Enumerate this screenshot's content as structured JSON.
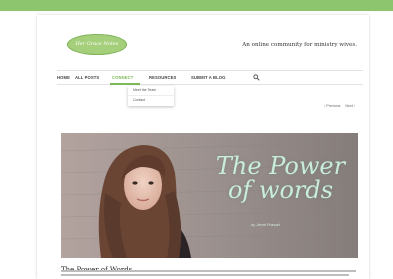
{
  "header": {
    "logo_text": "Her Grace Notes",
    "tagline": "An online community for ministry wives."
  },
  "nav": {
    "items": [
      {
        "label": "HOME"
      },
      {
        "label": "ALL POSTS"
      },
      {
        "label": "CONNECT"
      },
      {
        "label": "RESOURCES"
      },
      {
        "label": "SUBMIT A BLOG"
      }
    ],
    "active": "CONNECT",
    "search_icon": "search-icon"
  },
  "dropdown": {
    "items": [
      {
        "label": "Meet the Team"
      },
      {
        "label": "Contact"
      }
    ]
  },
  "post_nav": {
    "previous": "‹ Previous",
    "next": "Next ›"
  },
  "hero": {
    "title": "The Power of words",
    "byline": "by Jenni Prasad"
  },
  "post": {
    "title": "The Power of Words"
  },
  "colors": {
    "accent": "#7db95a",
    "top_bar": "#8cc56e",
    "hero_text": "#c9ecdc"
  }
}
